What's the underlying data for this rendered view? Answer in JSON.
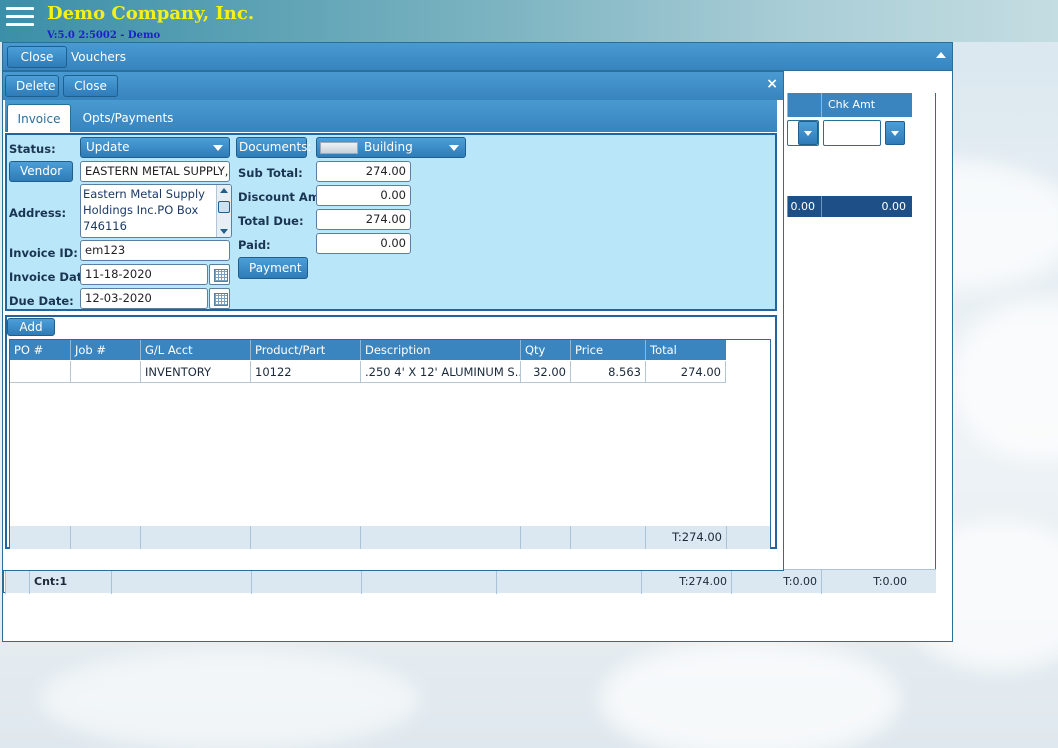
{
  "header": {
    "company": "Demo Company, Inc.",
    "version": "V:5.0 2:5002 - Demo"
  },
  "vouchers_window": {
    "close_label": "Close",
    "title": "Vouchers",
    "visible_column": "Chk Amt",
    "row_values": [
      "0.00",
      "0.00"
    ],
    "footer": {
      "count": "Cnt:1",
      "total1": "T:274.00",
      "total2": "T:0.00",
      "total3": "T:0.00"
    }
  },
  "invoice_window": {
    "delete_label": "Delete",
    "close_label": "Close",
    "close_x": "×",
    "tabs": [
      {
        "label": "Invoice",
        "active": true
      },
      {
        "label": "Opts/Payments",
        "active": false
      }
    ],
    "form": {
      "status_label": "Status:",
      "status_value": "Update",
      "vendor_button": "Vendor",
      "vendor_value": "EASTERN METAL SUPPLY, INC",
      "address_label": "Address:",
      "address_lines": [
        "Eastern Metal Supply",
        "Holdings Inc.PO Box",
        "746116"
      ],
      "invoice_id_label": "Invoice ID:",
      "invoice_id_value": "em123",
      "invoice_date_label": "Invoice Date:",
      "invoice_date_value": "11-18-2020",
      "due_date_label": "Due Date:",
      "due_date_value": "12-03-2020",
      "documents_button": "Documents:",
      "documents_value": "Building",
      "subtotal_label": "Sub Total:",
      "subtotal_value": "274.00",
      "discount_label": "Discount Amt:",
      "discount_value": "0.00",
      "totaldue_label": "Total Due:",
      "totaldue_value": "274.00",
      "paid_label": "Paid:",
      "paid_value": "0.00",
      "payment_button": "Payment"
    },
    "items": {
      "add_label": "Add",
      "columns": [
        "PO #",
        "Job #",
        "G/L Acct",
        "Product/Part",
        "Description",
        "Qty",
        "Price",
        "Total"
      ],
      "rows": [
        [
          "",
          "",
          "INVENTORY",
          "10122",
          ".250 4' X 12' ALUMINUM S...",
          "32.00",
          "8.563",
          "274.00"
        ]
      ],
      "footer_total": "T:274.00"
    }
  }
}
